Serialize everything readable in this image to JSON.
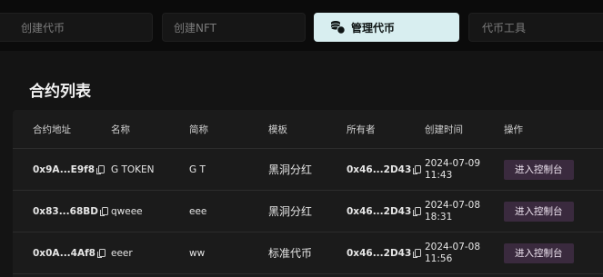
{
  "tabs": [
    {
      "label": "创建代币",
      "active": false
    },
    {
      "label": "创建NFT",
      "active": false
    },
    {
      "label": "管理代币",
      "active": true,
      "icon": "coins-icon"
    },
    {
      "label": "代币工具",
      "active": false
    }
  ],
  "section_title": "合约列表",
  "table": {
    "headers": [
      "合约地址",
      "名称",
      "简称",
      "模板",
      "所有者",
      "创建时间",
      "操作"
    ],
    "rows": [
      {
        "address": "0x9A...E9f8",
        "name": "G TOKEN",
        "symbol": "G T",
        "template": "黑洞分红",
        "owner": "0x46...2D43",
        "date": "2024-07-09",
        "time": "11:43",
        "action": "进入控制台"
      },
      {
        "address": "0x83...68BD",
        "name": "qweee",
        "symbol": "eee",
        "template": "黑洞分红",
        "owner": "0x46...2D43",
        "date": "2024-07-08",
        "time": "18:31",
        "action": "进入控制台"
      },
      {
        "address": "0x0A...4Af8",
        "name": "eeer",
        "symbol": "ww",
        "template": "标准代币",
        "owner": "0x46...2D43",
        "date": "2024-07-08",
        "time": "11:56",
        "action": "进入控制台"
      }
    ]
  },
  "colors": {
    "active_tab": "#d8eef0",
    "button": "#3a2a3e",
    "background": "#0b0b0b"
  }
}
